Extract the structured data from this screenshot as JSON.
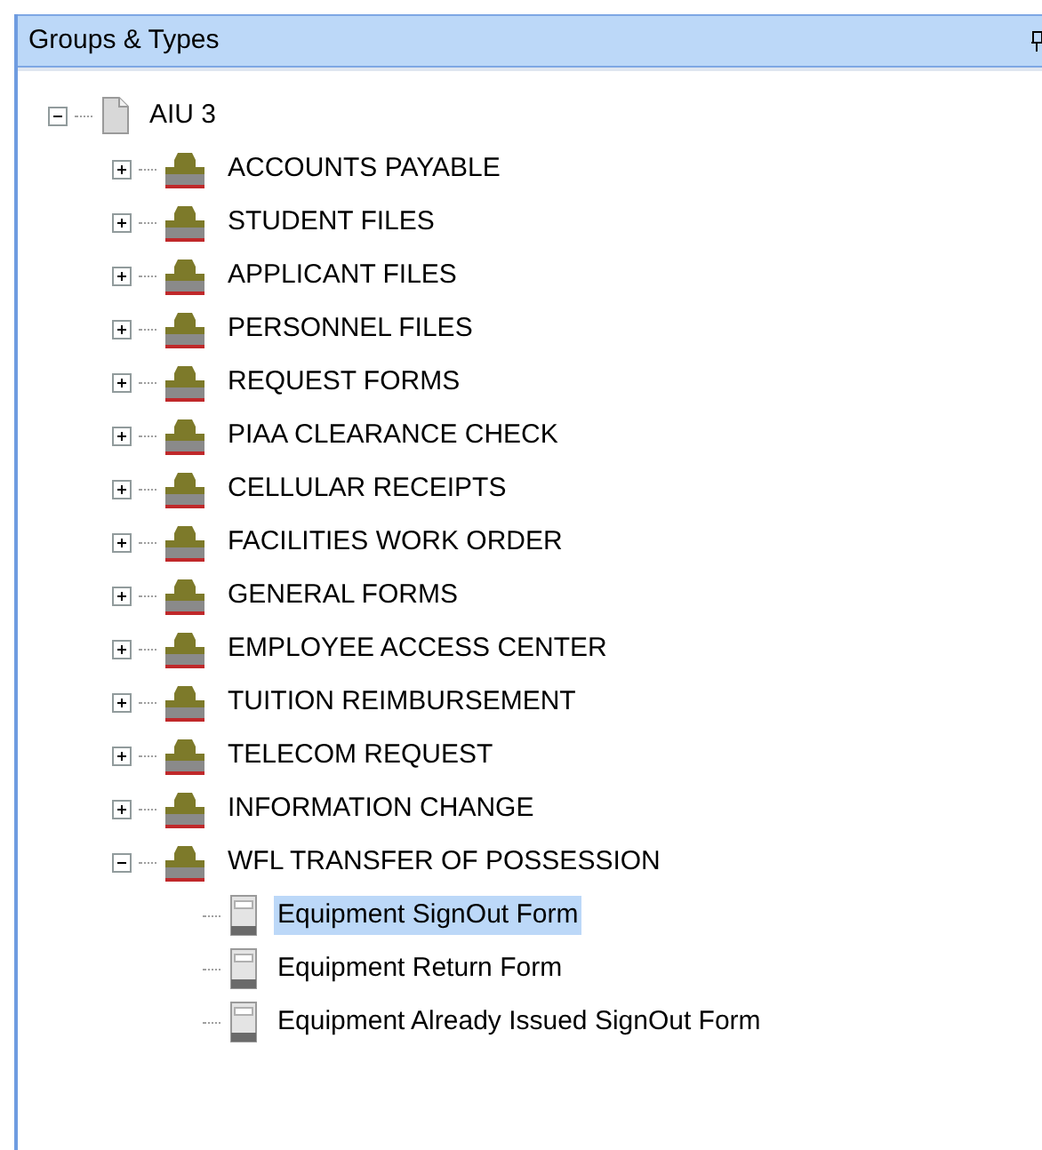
{
  "panel": {
    "title": "Groups & Types"
  },
  "tree": [
    {
      "label": "AIU 3",
      "kind": "root",
      "expanded": true,
      "children": [
        {
          "label": "ACCOUNTS PAYABLE",
          "kind": "group",
          "expanded": false
        },
        {
          "label": "STUDENT FILES",
          "kind": "group",
          "expanded": false
        },
        {
          "label": "APPLICANT FILES",
          "kind": "group",
          "expanded": false
        },
        {
          "label": "PERSONNEL FILES",
          "kind": "group",
          "expanded": false
        },
        {
          "label": "REQUEST FORMS",
          "kind": "group",
          "expanded": false
        },
        {
          "label": "PIAA CLEARANCE CHECK",
          "kind": "group",
          "expanded": false
        },
        {
          "label": "CELLULAR RECEIPTS",
          "kind": "group",
          "expanded": false
        },
        {
          "label": "FACILITIES WORK ORDER",
          "kind": "group",
          "expanded": false
        },
        {
          "label": "GENERAL FORMS",
          "kind": "group",
          "expanded": false
        },
        {
          "label": "EMPLOYEE ACCESS CENTER",
          "kind": "group",
          "expanded": false
        },
        {
          "label": "TUITION REIMBURSEMENT",
          "kind": "group",
          "expanded": false
        },
        {
          "label": "TELECOM REQUEST",
          "kind": "group",
          "expanded": false
        },
        {
          "label": "INFORMATION CHANGE",
          "kind": "group",
          "expanded": false
        },
        {
          "label": "WFL TRANSFER OF POSSESSION",
          "kind": "group",
          "expanded": true,
          "children": [
            {
              "label": "Equipment SignOut Form",
              "kind": "form",
              "selected": true
            },
            {
              "label": "Equipment Return Form",
              "kind": "form",
              "selected": false
            },
            {
              "label": "Equipment Already Issued SignOut Form",
              "kind": "form",
              "selected": false
            }
          ]
        }
      ]
    }
  ]
}
